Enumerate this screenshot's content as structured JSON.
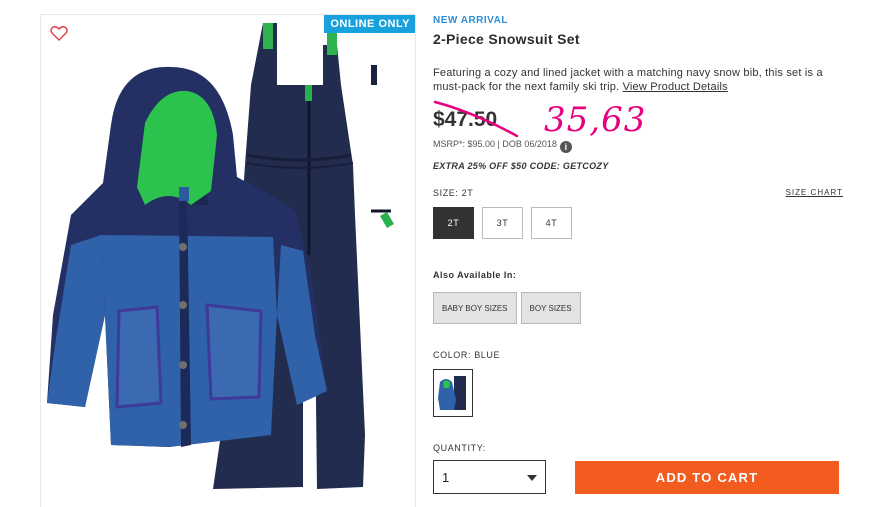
{
  "product": {
    "badge": "ONLINE ONLY",
    "favorite_icon": "heart-outline-icon",
    "image_alt": "2-Piece Snowsuit Set photo"
  },
  "info": {
    "eyebrow": "NEW ARRIVAL",
    "title": "2-Piece Snowsuit Set",
    "description": "Featuring a cozy and lined jacket with a matching navy snow bib, this set is a must-pack for the next family ski trip.",
    "details_link": "View Product Details",
    "price": "$47.50",
    "handwritten_price": "35,63",
    "msrp": "MSRP*: $95.00 | DOB 06/2018",
    "info_icon_glyph": "i",
    "promo": "EXTRA 25% OFF $50 CODE: GETCOZY",
    "size_label": "SIZE: 2T",
    "size_chart": "SIZE CHART",
    "sizes": [
      "2T",
      "3T",
      "4T"
    ],
    "selected_size": "2T",
    "also_available_label": "Also Available In:",
    "also_available": [
      "BABY BOY SIZES",
      "BOY SIZES"
    ],
    "color_label": "COLOR: BLUE",
    "quantity_label": "QUANTITY:",
    "quantity_value": "1",
    "add_to_cart": "ADD TO CART"
  },
  "colors": {
    "accent_blue": "#18a1dc",
    "cta_orange": "#f25c1f",
    "handwriting_pink": "#e6007e",
    "navy": "#1f2a4e",
    "jacket_blue": "#2f62a8",
    "lining_green": "#22c34b"
  }
}
